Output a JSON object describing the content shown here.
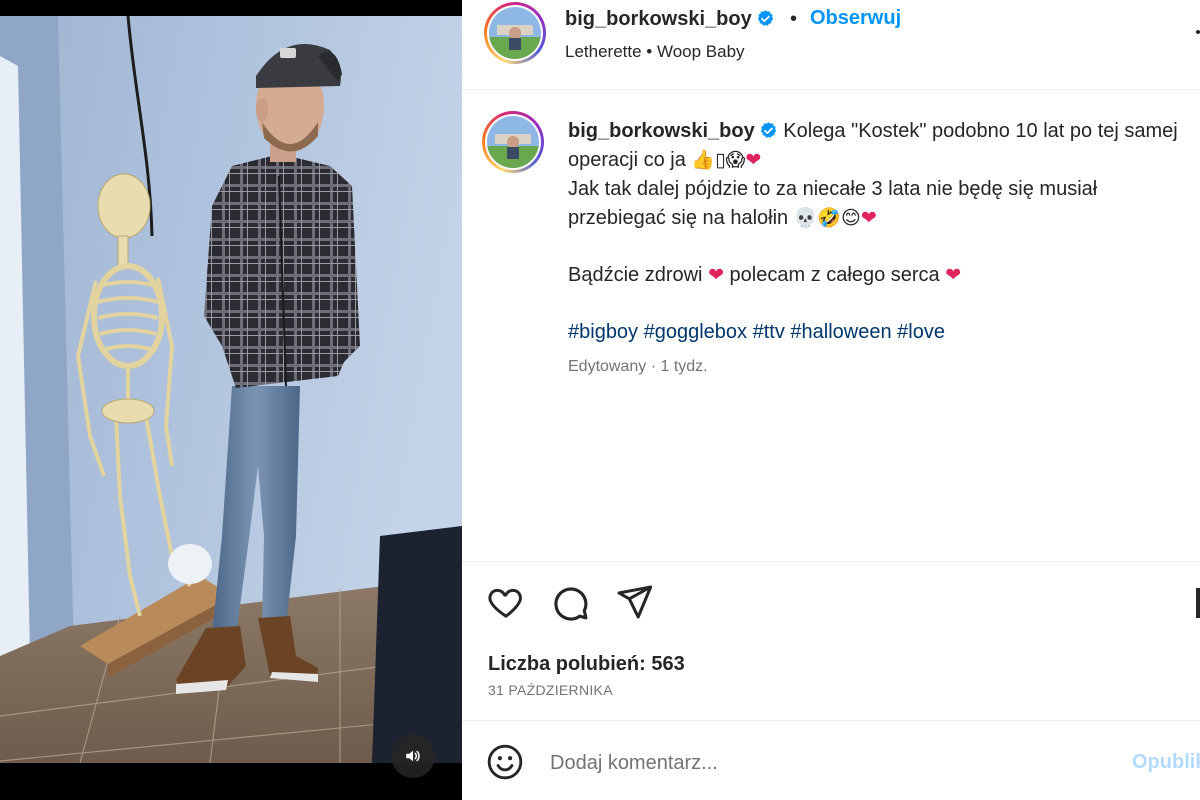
{
  "post": {
    "username": "big_borkowski_boy",
    "verified": true,
    "dot": "•",
    "follow_label": "Obserwuj",
    "audio": "Letherette • Woop Baby",
    "media": {
      "sound_icon": "speaker-icon"
    }
  },
  "caption": {
    "username": "big_borkowski_boy",
    "line1_text": "Kolega \"Kostek\" podobno 10 lat po tej samej operacji co ja ",
    "line1_emoji": "👍▯😱",
    "line1_heart": "❤",
    "line2_text": "Jak tak dalej pójdzie to za niecałe 3 lata nie będę się musiał przebiegać się na halołin ",
    "line2_emoji": "💀🤣😊",
    "line2_heart": "❤",
    "line3_a": "Bądźcie zdrowi ",
    "line3_heart1": "❤",
    "line3_b": " polecam z całego serca ",
    "line3_heart2": "❤",
    "hashtags": "#bigboy #gogglebox #ttv #halloween #love",
    "meta": "Edytowany · 1 tydz."
  },
  "actions": {
    "like_icon": "heart-icon",
    "comment_icon": "comment-icon",
    "share_icon": "paper-plane-icon",
    "likes": "Liczba polubień: 563",
    "date": "31 PAŹDZIERNIKA"
  },
  "comment": {
    "placeholder": "Dodaj komentarz...",
    "post_label": "Opublikuj"
  },
  "colors": {
    "accent": "#0095f6",
    "hashtag": "#00376b",
    "muted": "#737373",
    "heart": "#e0245e"
  }
}
